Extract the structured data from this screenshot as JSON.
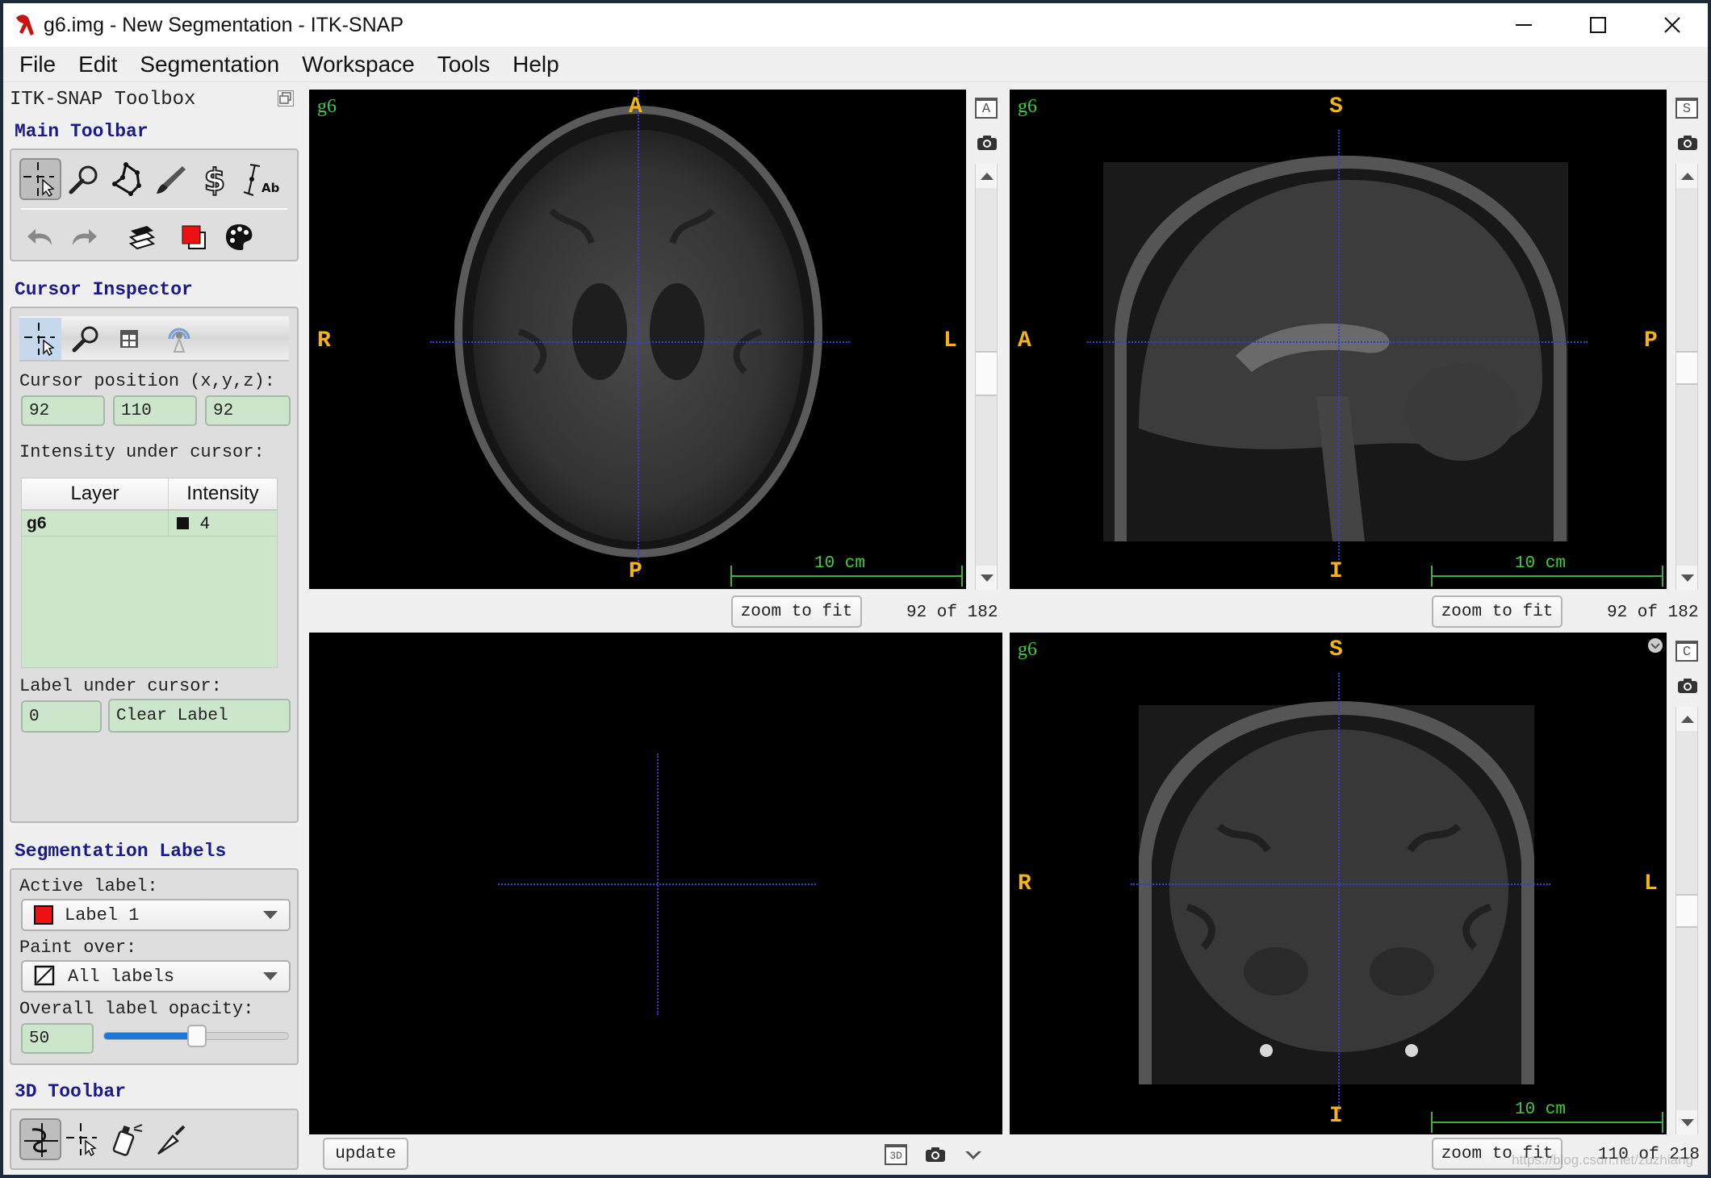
{
  "window": {
    "title": "g6.img - New Segmentation - ITK-SNAP",
    "controls": [
      "minimize",
      "maximize",
      "close"
    ]
  },
  "menu": [
    "File",
    "Edit",
    "Segmentation",
    "Workspace",
    "Tools",
    "Help"
  ],
  "toolbox": {
    "title": "ITK-SNAP Toolbox",
    "main_toolbar": {
      "title": "Main Toolbar",
      "tools": [
        "crosshair-tool",
        "zoom-pan-tool",
        "polygon-tool",
        "paintbrush-tool",
        "snake-tool",
        "annotation-tool"
      ],
      "selected_tool": "crosshair-tool",
      "actions": [
        "undo",
        "redo",
        "layers",
        "label-color",
        "palette"
      ]
    },
    "cursor_inspector": {
      "title": "Cursor Inspector",
      "tabs": [
        "cursor",
        "zoom",
        "layout",
        "sync"
      ],
      "cursor_position_label": "Cursor position (x,y,z):",
      "cursor_x": "92",
      "cursor_y": "110",
      "cursor_z": "92",
      "intensity_label": "Intensity under cursor:",
      "table_headers": [
        "Layer",
        "Intensity"
      ],
      "table_rows": [
        {
          "layer": "g6",
          "intensity": "4",
          "swatch": "#111111"
        }
      ],
      "label_under_cursor_label": "Label under cursor:",
      "label_id": "0",
      "label_name": "Clear Label"
    },
    "segmentation_labels": {
      "title": "Segmentation Labels",
      "active_label_caption": "Active label:",
      "active_label": "Label 1",
      "active_label_color": "#ee1111",
      "paint_over_caption": "Paint over:",
      "paint_over": "All labels",
      "opacity_caption": "Overall label opacity:",
      "opacity_value": "50",
      "opacity_fraction": 0.5
    },
    "toolbar_3d": {
      "title": "3D Toolbar",
      "tools": [
        "rotate-3d-tool",
        "crosshair-3d-tool",
        "spray-paint-tool",
        "scalpel-tool"
      ],
      "selected_tool": "rotate-3d-tool"
    }
  },
  "views": {
    "axial": {
      "layer": "g6",
      "top": "A",
      "bottom": "P",
      "left": "R",
      "right": "L",
      "scale": "10 cm",
      "view_button": "A",
      "zoom_button": "zoom to fit",
      "slice": "92 of 182"
    },
    "sagittal": {
      "layer": "g6",
      "top": "S",
      "bottom": "I",
      "left": "A",
      "right": "P",
      "scale": "10 cm",
      "view_button": "S",
      "zoom_button": "zoom to fit",
      "slice": "92 of 182"
    },
    "three_d": {
      "update_button": "update",
      "view_button": "3D"
    },
    "coronal": {
      "layer": "g6",
      "top": "S",
      "bottom": "I",
      "left": "R",
      "right": "L",
      "scale": "10 cm",
      "view_button": "C",
      "zoom_button": "zoom to fit",
      "slice": "110 of 218"
    }
  },
  "colors": {
    "orientation_label": "#f2b416",
    "layer_label": "#3fcc3f",
    "crosshair": "#3a3ad8",
    "section_title": "#1a1a8a",
    "field_bg": "#cce6cc"
  },
  "watermark": "https://blog.csdn.net/zuzhiang"
}
